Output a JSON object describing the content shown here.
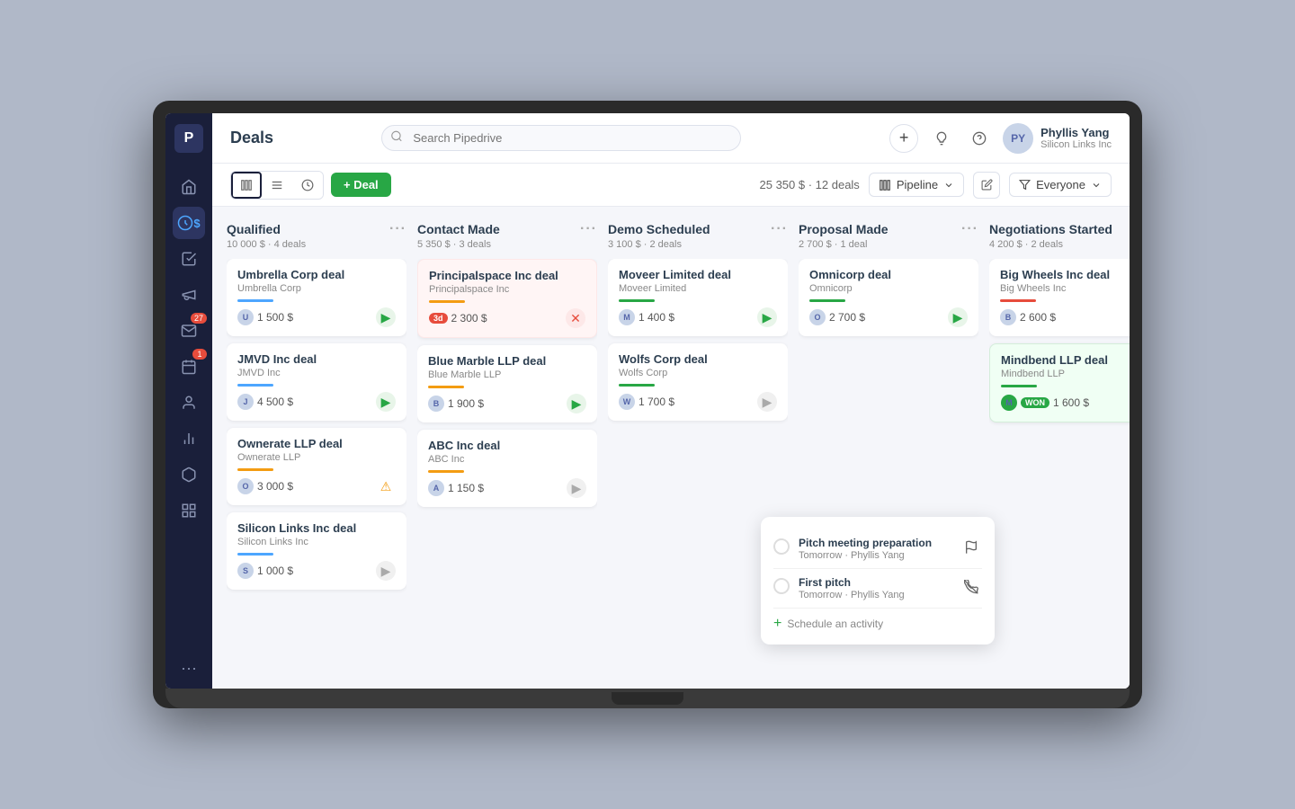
{
  "app": {
    "title": "Deals"
  },
  "header": {
    "search_placeholder": "Search Pipedrive",
    "user": {
      "name": "Phyllis Yang",
      "company": "Silicon Links Inc"
    }
  },
  "toolbar": {
    "add_deal": "+ Deal",
    "summary": "25 350 $ · 12 deals",
    "pipeline_label": "Pipeline",
    "filter_label": "Everyone"
  },
  "columns": [
    {
      "id": "qualified",
      "title": "Qualified",
      "subtitle": "10 000 $ · 4 deals",
      "bar_color": "#4da6ff",
      "cards": [
        {
          "title": "Umbrella Corp deal",
          "company": "Umbrella Corp",
          "amount": "1 500 $",
          "action": "green",
          "bar": "#4da6ff"
        },
        {
          "title": "JMVD Inc deal",
          "company": "JMVD Inc",
          "amount": "4 500 $",
          "action": "green",
          "bar": "#4da6ff"
        },
        {
          "title": "Ownerate LLP deal",
          "company": "Ownerate LLP",
          "amount": "3 000 $",
          "action": "warning",
          "bar": "#f39c12"
        },
        {
          "title": "Silicon Links Inc deal",
          "company": "Silicon Links Inc",
          "amount": "1 000 $",
          "action": "gray",
          "bar": "#4da6ff"
        }
      ]
    },
    {
      "id": "contact-made",
      "title": "Contact Made",
      "subtitle": "5 350 $ · 3 deals",
      "bar_color": "#f39c12",
      "cards": [
        {
          "title": "Principalspace Inc deal",
          "company": "Principalspace Inc",
          "amount": "2 300 $",
          "action": "red",
          "bar": "#f39c12",
          "overdue": "3d",
          "is_overdue": true
        },
        {
          "title": "Blue Marble LLP deal",
          "company": "Blue Marble LLP",
          "amount": "1 900 $",
          "action": "green",
          "bar": "#f39c12"
        },
        {
          "title": "ABC Inc deal",
          "company": "ABC Inc",
          "amount": "1 150 $",
          "action": "gray",
          "bar": "#f39c12"
        }
      ]
    },
    {
      "id": "demo-scheduled",
      "title": "Demo Scheduled",
      "subtitle": "3 100 $ · 2 deals",
      "bar_color": "#28a745",
      "cards": [
        {
          "title": "Moveer Limited deal",
          "company": "Moveer Limited",
          "amount": "1 400 $",
          "action": "green",
          "bar": "#28a745"
        },
        {
          "title": "Wolfs Corp deal",
          "company": "Wolfs Corp",
          "amount": "1 700 $",
          "action": "gray",
          "bar": "#28a745",
          "has_activity": true
        }
      ]
    },
    {
      "id": "proposal-made",
      "title": "Proposal Made",
      "subtitle": "2 700 $ · 1 deal",
      "bar_color": "#9b59b6",
      "cards": [
        {
          "title": "Omnicorp deal",
          "company": "Omnicorp",
          "amount": "2 700 $",
          "action": "green",
          "bar": "#9b59b6"
        }
      ]
    },
    {
      "id": "negotiations-started",
      "title": "Negotiations Started",
      "subtitle": "4 200 $ · 2 deals",
      "bar_color": "#e74c3c",
      "cards": [
        {
          "title": "Big Wheels Inc deal",
          "company": "Big Wheels Inc",
          "amount": "2 600 $",
          "action": "green",
          "bar": "#e74c3c"
        },
        {
          "title": "Mindbend LLP deal",
          "company": "Mindbend LLP",
          "amount": "1 600 $",
          "action": "gray",
          "bar": "#28a745",
          "won": true,
          "highlighted": true
        }
      ]
    }
  ],
  "activity_popup": {
    "activities": [
      {
        "title": "Pitch meeting preparation",
        "meta": "Tomorrow · Phyllis Yang",
        "icon": "flag"
      },
      {
        "title": "First pitch",
        "meta": "Tomorrow · Phyllis Yang",
        "icon": "phone"
      }
    ],
    "schedule_label": "Schedule an activity"
  },
  "sidebar": {
    "logo": "P",
    "items": [
      {
        "id": "home",
        "icon": "home",
        "active": false
      },
      {
        "id": "deals",
        "icon": "dollar",
        "active": true
      },
      {
        "id": "tasks",
        "icon": "check",
        "active": false
      },
      {
        "id": "megaphone",
        "icon": "megaphone",
        "active": false
      },
      {
        "id": "mail",
        "icon": "mail",
        "active": false,
        "badge": "27"
      },
      {
        "id": "calendar",
        "icon": "calendar",
        "active": false,
        "badge": "1"
      },
      {
        "id": "contacts",
        "icon": "contacts",
        "active": false
      },
      {
        "id": "chart",
        "icon": "chart",
        "active": false
      },
      {
        "id": "box",
        "icon": "box",
        "active": false
      },
      {
        "id": "grid",
        "icon": "grid",
        "active": false
      }
    ]
  }
}
